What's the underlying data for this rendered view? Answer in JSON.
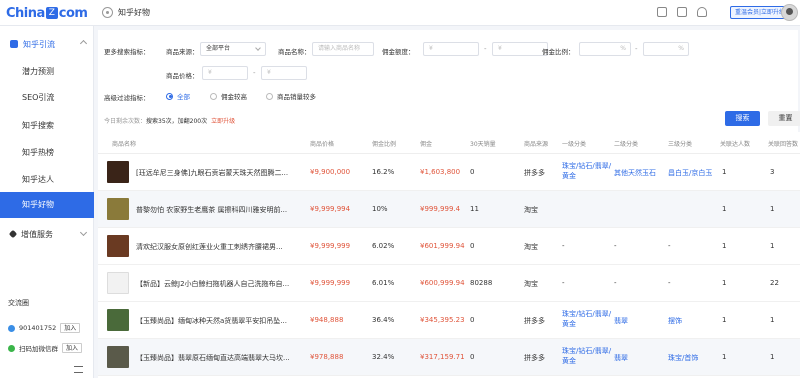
{
  "header": {
    "logo": "China",
    "logo_suffix": "com",
    "page": "知乎好物",
    "vip_label": "重温会员|立即升级"
  },
  "sidebar": {
    "group1": "知乎引流",
    "items": [
      "潜力预测",
      "SEO引流",
      "知乎搜索",
      "知乎热榜",
      "知乎达人",
      "知乎好物"
    ],
    "group2": "增值服务",
    "exchange_title": "交流圈",
    "qq_number": "901401752",
    "qq_join": "加入",
    "wechat_label": "扫码加微信群",
    "wechat_join": "加入"
  },
  "filters": {
    "more_label": "更多搜索指标：",
    "source_label": "商品来源：",
    "source_value": "全部平台",
    "name_label": "商品名称：",
    "name_placeholder": "请输入商品名称",
    "commission_label": "佣金额度：",
    "currency": "¥",
    "ratio_label": "佣金比例：",
    "percent": "%",
    "price_label": "商品价格：",
    "dash": "-",
    "advanced_label": "高级过滤指标：",
    "radios": [
      "全部",
      "佣金较高",
      "商品销量较多"
    ],
    "quota_prefix": "今日剩余次数：",
    "quota_value": "搜索35次，加翻200次",
    "quota_upgrade": "立即升级",
    "search_button": "搜索",
    "reset_button": "重置"
  },
  "table": {
    "headers": [
      "商品名称",
      "商品价格",
      "佣金比例",
      "佣金",
      "30天销量",
      "商品来源",
      "一级分类",
      "二级分类",
      "三级分类",
      "关联达人数",
      "关联回答数"
    ],
    "rows": [
      {
        "name": "[珏远牟尼三身佛]九眼石贡岩蒙天珠天然图腾二...",
        "price": "¥9,900,000",
        "ratio": "16.2%",
        "commission": "¥1,603,800",
        "sales": "0",
        "source": "拼多多",
        "cat1": "珠宝/钻石/翡翠/黄金",
        "cat2": "其他天然玉石",
        "cat3": "昌白玉/京白玉",
        "experts": "1",
        "answers": "3",
        "thumb": "#3a2418"
      },
      {
        "name": "普黎勿怕 农家野生老鹰茶 属擦科四川雅安明前...",
        "price": "¥9,999,994",
        "ratio": "10%",
        "commission": "¥999,999.4",
        "sales": "11",
        "source": "淘宝",
        "cat1": "",
        "cat2": "",
        "cat3": "",
        "experts": "1",
        "answers": "1",
        "thumb": "#8a7a3a"
      },
      {
        "name": "清欢纪汉服女原创红莲业火重工刺绣齐腰裙男...",
        "price": "¥9,999,999",
        "ratio": "6.02%",
        "commission": "¥601,999.94",
        "sales": "0",
        "source": "淘宝",
        "cat1": "-",
        "cat2": "-",
        "cat3": "-",
        "experts": "1",
        "answers": "1",
        "thumb": "#6a3a22"
      },
      {
        "name": "【新品】云鲸J2小白鲸扫拖机器人自己洗拖布自...",
        "price": "¥9,999,999",
        "ratio": "6.01%",
        "commission": "¥600,999.94",
        "sales": "80288",
        "source": "淘宝",
        "cat1": "-",
        "cat2": "-",
        "cat3": "-",
        "experts": "1",
        "answers": "22",
        "thumb": "#f2f2f2"
      },
      {
        "name": "【玉臻尚品】缅甸冰种天然a货翡翠平安扣吊坠...",
        "price": "¥948,888",
        "ratio": "36.4%",
        "commission": "¥345,395.23",
        "sales": "0",
        "source": "拼多多",
        "cat1": "珠宝/钻石/翡翠/黄金",
        "cat2": "翡翠",
        "cat3": "摆饰",
        "experts": "1",
        "answers": "1",
        "thumb": "#4a6a3a"
      },
      {
        "name": "【玉臻尚品】翡翠原石缅甸直达高端翡翠大马坎...",
        "price": "¥978,888",
        "ratio": "32.4%",
        "commission": "¥317,159.71",
        "sales": "0",
        "source": "拼多多",
        "cat1": "珠宝/钻石/翡翠/黄金",
        "cat2": "翡翠",
        "cat3": "珠宝/首饰",
        "experts": "1",
        "answers": "1",
        "thumb": "#5a5a4a"
      }
    ]
  }
}
